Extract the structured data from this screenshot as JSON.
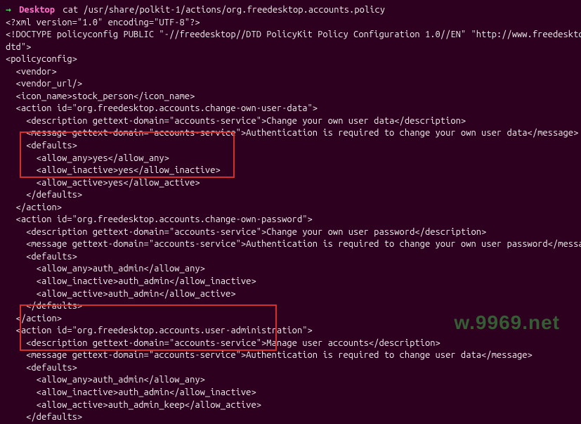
{
  "prompt": {
    "arrow": "→",
    "host": "Desktop",
    "command": "cat /usr/share/polkit-1/actions/org.freedesktop.accounts.policy"
  },
  "lines": {
    "l1": "<?xml version=\"1.0\" encoding=\"UTF-8\"?>",
    "l2": "<!DOCTYPE policyconfig PUBLIC \"-//freedesktop//DTD PolicyKit Policy Configuration 1.0//EN\" \"http://www.freedesktop.o",
    "l3": "dtd\">",
    "l4": "<policyconfig>",
    "l5": "  <vendor>",
    "l6": "  <vendor_url/>",
    "l7": "  <icon_name>stock_person</icon_name>",
    "l8": "  <action id=\"org.freedesktop.accounts.change-own-user-data\">",
    "l9": "    <description gettext-domain=\"accounts-service\">Change your own user data</description>",
    "l10": "    <message gettext-domain=\"accounts-service\">Authentication is required to change your own user data</message>",
    "l11": "    <defaults>",
    "l12": "      <allow_any>yes</allow_any>",
    "l13": "      <allow_inactive>yes</allow_inactive>",
    "l14": "      <allow_active>yes</allow_active>",
    "l15": "    </defaults>",
    "l16": "  </action>",
    "l17": "  <action id=\"org.freedesktop.accounts.change-own-password\">",
    "l18": "    <description gettext-domain=\"accounts-service\">Change your own user password</description>",
    "l19": "    <message gettext-domain=\"accounts-service\">Authentication is required to change your own user password</message>",
    "l20": "    <defaults>",
    "l21": "      <allow_any>auth_admin</allow_any>",
    "l22": "      <allow_inactive>auth_admin</allow_inactive>",
    "l23": "      <allow_active>auth_admin</allow_active>",
    "l24": "    </defaults>",
    "l25": "  </action>",
    "l26": "  <action id=\"org.freedesktop.accounts.user-administration\">",
    "l27": "    <description gettext-domain=\"accounts-service\">Manage user accounts</description>",
    "l28": "    <message gettext-domain=\"accounts-service\">Authentication is required to change user data</message>",
    "l29": "    <defaults>",
    "l30": "      <allow_any>auth_admin</allow_any>",
    "l31": "      <allow_inactive>auth_admin</allow_inactive>",
    "l32": "      <allow_active>auth_admin_keep</allow_active>",
    "l33": "    </defaults>"
  },
  "watermark": "w.9969.net"
}
